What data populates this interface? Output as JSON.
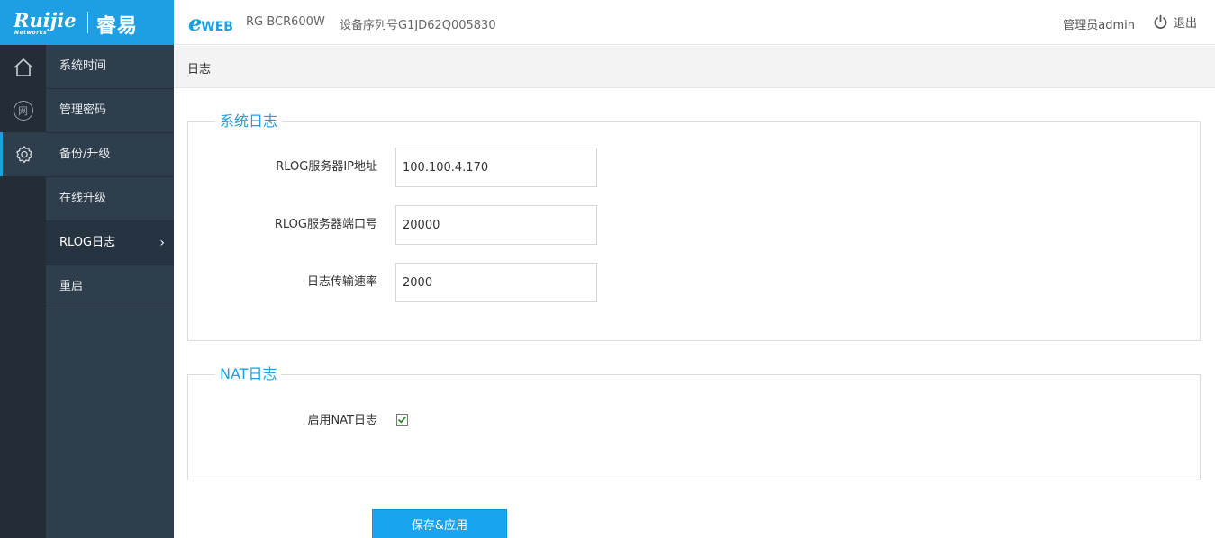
{
  "header": {
    "logo_main": "Ruijie",
    "logo_sub": "Networks",
    "logo_cn": "睿易",
    "eweb_e": "e",
    "eweb_w": "WEB",
    "device_model": "RG-BCR600W",
    "device_serial": "设备序列号G1JD62Q005830",
    "admin": "管理员admin",
    "logout": "退出"
  },
  "rail": {
    "items": [
      {
        "name": "home-icon"
      },
      {
        "name": "network-icon",
        "glyph": "网"
      },
      {
        "name": "gear-icon",
        "active": true
      }
    ]
  },
  "submenu": {
    "items": [
      {
        "label": "系统时间"
      },
      {
        "label": "管理密码"
      },
      {
        "label": "备份/升级"
      },
      {
        "label": "在线升级"
      },
      {
        "label": "RLOG日志",
        "active": true,
        "arrow": "›"
      },
      {
        "label": "重启"
      }
    ]
  },
  "breadcrumb": "日志",
  "syslog": {
    "legend": "系统日志",
    "fields": [
      {
        "label": "RLOG服务器IP地址",
        "value": "100.100.4.170"
      },
      {
        "label": "RLOG服务器端口号",
        "value": "20000"
      },
      {
        "label": "日志传输速率",
        "value": "2000"
      }
    ]
  },
  "natlog": {
    "legend": "NAT日志",
    "enable_label": "启用NAT日志",
    "enabled": true
  },
  "save_button": "保存&应用",
  "colors": {
    "accent": "#1e9ee3",
    "sidebar_dark": "#222d38",
    "sidebar": "#2f3e4c",
    "button": "#1aa3ee"
  }
}
